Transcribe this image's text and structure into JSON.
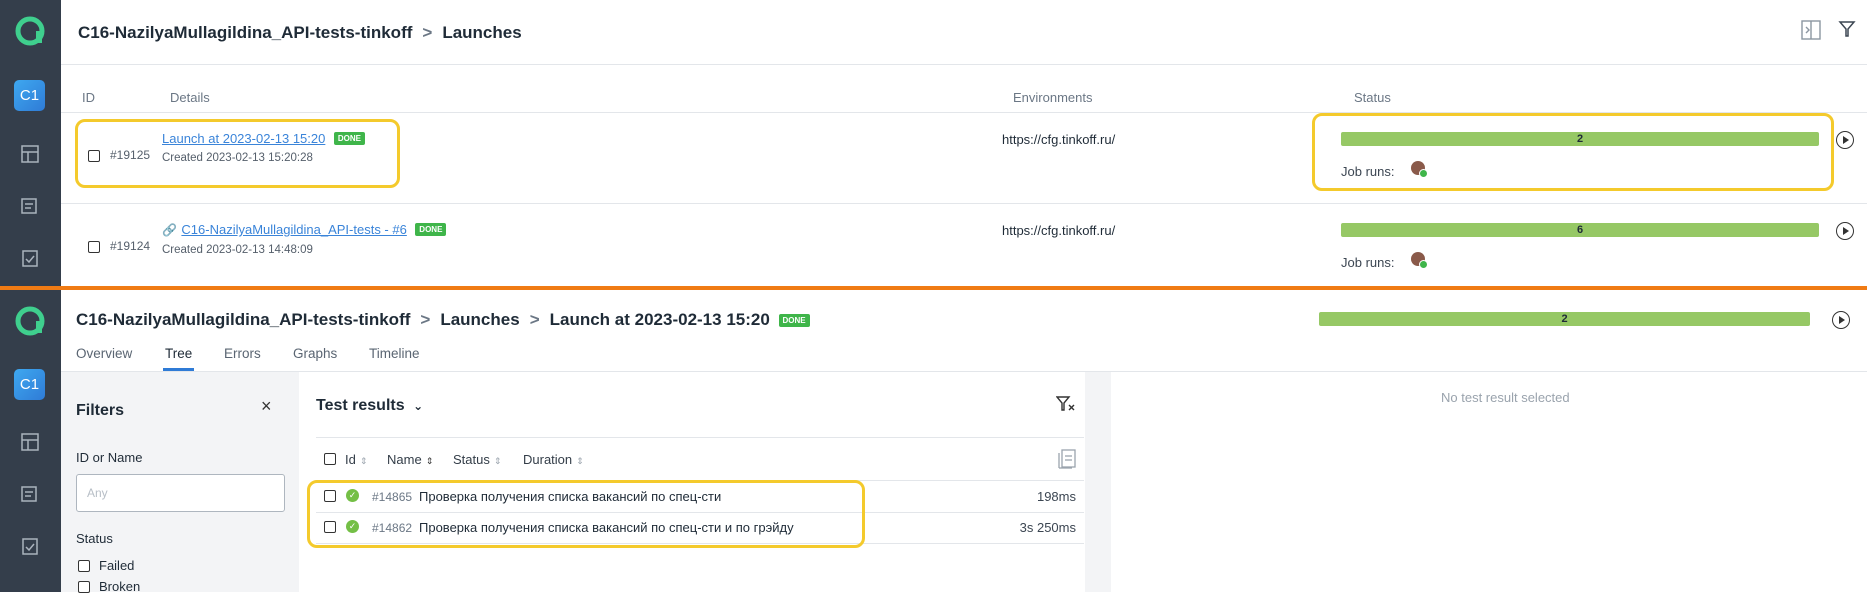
{
  "top": {
    "breadcrumb": {
      "project": "C16-NazilyaMullagildina_API-tests-tinkoff",
      "page": "Launches"
    },
    "sidebar": {
      "project_badge": "C1"
    },
    "columns": {
      "id": "ID",
      "details": "Details",
      "environments": "Environments",
      "status": "Status"
    },
    "launches": [
      {
        "id": "#19125",
        "name": "Launch at 2023-02-13 15:20",
        "badge": "DONE",
        "created": "Created 2023-02-13 15:20:28",
        "environment": "https://cfg.tinkoff.ru/",
        "status_count": "2",
        "job_runs_label": "Job runs:"
      },
      {
        "id": "#19124",
        "name": "C16-NazilyaMullagildina_API-tests - #6",
        "badge": "DONE",
        "created": "Created 2023-02-13 14:48:09",
        "environment": "https://cfg.tinkoff.ru/",
        "status_count": "6",
        "job_runs_label": "Job runs:"
      }
    ]
  },
  "bottom": {
    "breadcrumb": {
      "project": "C16-NazilyaMullagildina_API-tests-tinkoff",
      "launches": "Launches",
      "launch": "Launch at 2023-02-13 15:20",
      "badge": "DONE"
    },
    "sidebar": {
      "project_badge": "C1"
    },
    "status_count": "2",
    "tabs": [
      "Overview",
      "Tree",
      "Errors",
      "Graphs",
      "Timeline"
    ],
    "active_tab": "Tree",
    "filters": {
      "title": "Filters",
      "id_label": "ID or Name",
      "id_placeholder": "Any",
      "status_label": "Status",
      "status_options": [
        "Failed",
        "Broken"
      ]
    },
    "results": {
      "title": "Test results",
      "columns": [
        "Id",
        "Name",
        "Status",
        "Duration"
      ],
      "rows": [
        {
          "id": "#14865",
          "name": "Проверка получения списка вакансий по спец-сти",
          "duration": "198ms",
          "status": "passed"
        },
        {
          "id": "#14862",
          "name": "Проверка получения списка вакансий по спец-сти и по грэйду",
          "duration": "3s 250ms",
          "status": "passed"
        }
      ]
    },
    "detail_empty": "No test result selected"
  },
  "colors": {
    "accent_orange": "#f07b14",
    "highlight_yellow": "#f4ca2c",
    "done_green": "#3fb54a",
    "bar_green": "#96c865",
    "sidebar": "#343e4b",
    "link_blue": "#3a84d9"
  }
}
